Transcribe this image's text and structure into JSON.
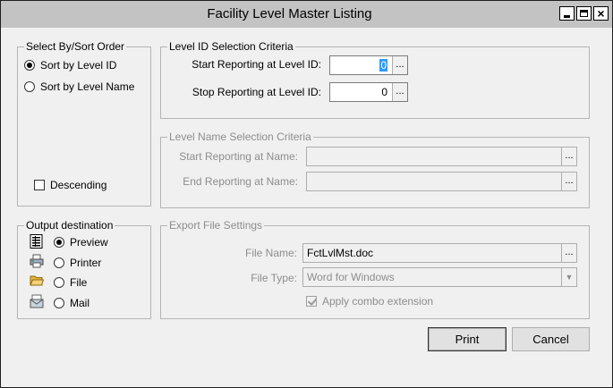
{
  "window": {
    "title": "Facility Level  Master Listing",
    "close_glyph": "×"
  },
  "sort_group": {
    "legend": "Select By/Sort Order",
    "options": [
      {
        "label": "Sort by Level  ID",
        "selected": true
      },
      {
        "label": "Sort by Level  Name",
        "selected": false
      }
    ],
    "descending_label": "Descending",
    "descending_checked": false
  },
  "level_id_group": {
    "legend": "Level ID Selection Criteria",
    "start_label": "Start Reporting at Level ID:",
    "start_value": "0",
    "stop_label": "Stop Reporting at Level ID:",
    "stop_value": "0",
    "browse_glyph": "..."
  },
  "level_name_group": {
    "legend": "Level Name Selection Criteria",
    "start_label": "Start Reporting at Name:",
    "start_value": "",
    "end_label": "End Reporting at Name:",
    "end_value": "",
    "browse_glyph": "..."
  },
  "output_group": {
    "legend": "Output destination",
    "options": [
      {
        "label": "Preview",
        "icon": "preview-icon",
        "selected": true
      },
      {
        "label": "Printer",
        "icon": "printer-icon",
        "selected": false
      },
      {
        "label": "File",
        "icon": "folder-icon",
        "selected": false
      },
      {
        "label": "Mail",
        "icon": "mail-icon",
        "selected": false
      }
    ]
  },
  "export_group": {
    "legend": "Export  File Settings",
    "file_name_label": "File Name:",
    "file_name_value": "FctLvlMst.doc",
    "browse_glyph": "...",
    "file_type_label": "File Type:",
    "file_type_value": "Word for Windows",
    "combo_label": "Apply combo extension",
    "combo_checked": true
  },
  "buttons": {
    "print": "Print",
    "cancel": "Cancel"
  },
  "colors": {
    "title_bar": "#c3c3c3",
    "selection": "#3399ff",
    "disabled_text": "#8d8d8d"
  }
}
